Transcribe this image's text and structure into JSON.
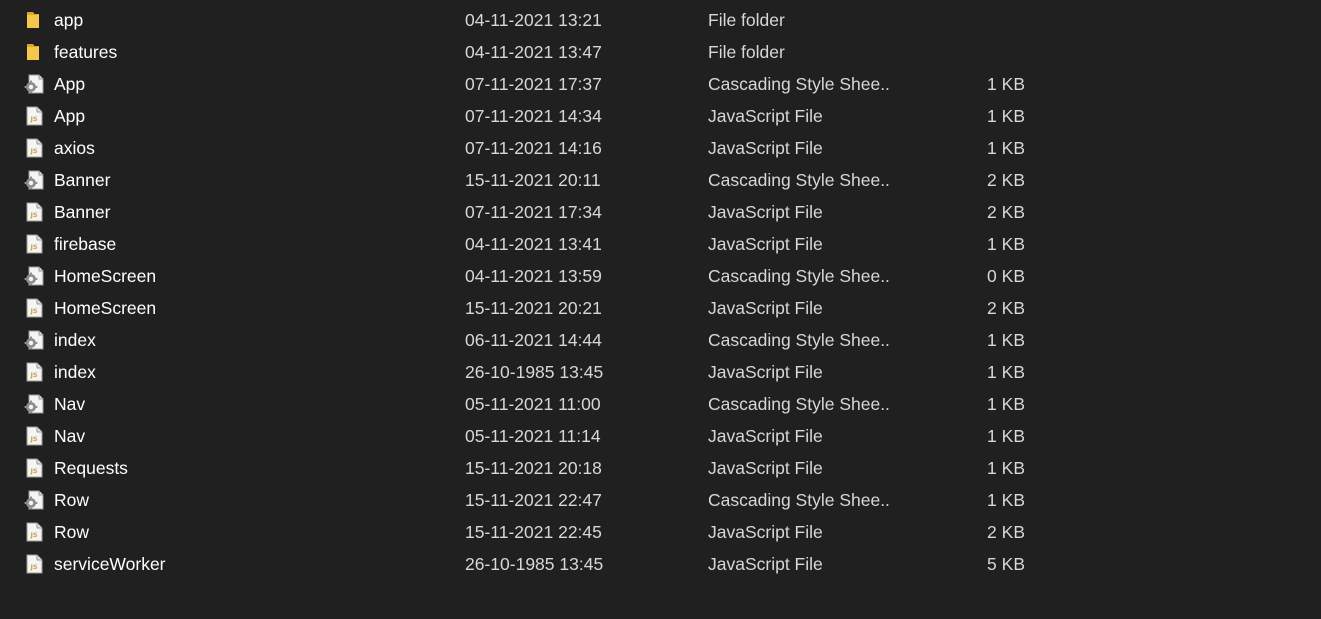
{
  "files": [
    {
      "name": "app",
      "modified": "04-11-2021 13:21",
      "type": "File folder",
      "size": "",
      "icon": "folder-icon"
    },
    {
      "name": "features",
      "modified": "04-11-2021 13:47",
      "type": "File folder",
      "size": "",
      "icon": "folder-icon"
    },
    {
      "name": "App",
      "modified": "07-11-2021 17:37",
      "type": "Cascading Style Shee...",
      "size": "1 KB",
      "icon": "css-file-icon"
    },
    {
      "name": "App",
      "modified": "07-11-2021 14:34",
      "type": "JavaScript File",
      "size": "1 KB",
      "icon": "js-file-icon"
    },
    {
      "name": "axios",
      "modified": "07-11-2021 14:16",
      "type": "JavaScript File",
      "size": "1 KB",
      "icon": "js-file-icon"
    },
    {
      "name": "Banner",
      "modified": "15-11-2021 20:11",
      "type": "Cascading Style Shee...",
      "size": "2 KB",
      "icon": "css-file-icon"
    },
    {
      "name": "Banner",
      "modified": "07-11-2021 17:34",
      "type": "JavaScript File",
      "size": "2 KB",
      "icon": "js-file-icon"
    },
    {
      "name": "firebase",
      "modified": "04-11-2021 13:41",
      "type": "JavaScript File",
      "size": "1 KB",
      "icon": "js-file-icon"
    },
    {
      "name": "HomeScreen",
      "modified": "04-11-2021 13:59",
      "type": "Cascading Style Shee...",
      "size": "0 KB",
      "icon": "css-file-icon"
    },
    {
      "name": "HomeScreen",
      "modified": "15-11-2021 20:21",
      "type": "JavaScript File",
      "size": "2 KB",
      "icon": "js-file-icon"
    },
    {
      "name": "index",
      "modified": "06-11-2021 14:44",
      "type": "Cascading Style Shee...",
      "size": "1 KB",
      "icon": "css-file-icon"
    },
    {
      "name": "index",
      "modified": "26-10-1985 13:45",
      "type": "JavaScript File",
      "size": "1 KB",
      "icon": "js-file-icon"
    },
    {
      "name": "Nav",
      "modified": "05-11-2021 11:00",
      "type": "Cascading Style Shee...",
      "size": "1 KB",
      "icon": "css-file-icon"
    },
    {
      "name": "Nav",
      "modified": "05-11-2021 11:14",
      "type": "JavaScript File",
      "size": "1 KB",
      "icon": "js-file-icon"
    },
    {
      "name": "Requests",
      "modified": "15-11-2021 20:18",
      "type": "JavaScript File",
      "size": "1 KB",
      "icon": "js-file-icon"
    },
    {
      "name": "Row",
      "modified": "15-11-2021 22:47",
      "type": "Cascading Style Shee...",
      "size": "1 KB",
      "icon": "css-file-icon"
    },
    {
      "name": "Row",
      "modified": "15-11-2021 22:45",
      "type": "JavaScript File",
      "size": "2 KB",
      "icon": "js-file-icon"
    },
    {
      "name": "serviceWorker",
      "modified": "26-10-1985 13:45",
      "type": "JavaScript File",
      "size": "5 KB",
      "icon": "js-file-icon"
    }
  ],
  "colors": {
    "background": "#202020",
    "text": "#ffffff",
    "folder": "#f3c443",
    "js_badge": "#d4b44a"
  }
}
